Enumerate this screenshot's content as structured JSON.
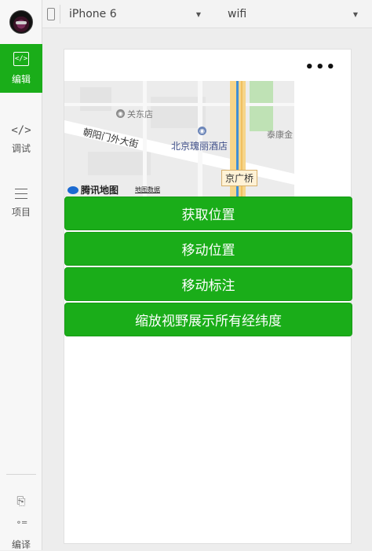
{
  "sidebar": {
    "items": [
      {
        "label": "编辑",
        "icon": "code-box-icon"
      },
      {
        "label": "调试",
        "icon": "code-icon"
      },
      {
        "label": "项目",
        "icon": "menu-icon"
      }
    ],
    "compile_label": "编译"
  },
  "toolbar": {
    "device": "iPhone 6",
    "network": "wifi"
  },
  "map": {
    "labels": {
      "guandong_store": "关东店",
      "chaoyangmen_street": "朝阳门外大街",
      "beijing_hotel": "北京瑰丽酒店",
      "taikang": "泰康金",
      "jingguang_bridge": "京广桥"
    },
    "logo_text": "腾讯地图",
    "credit_text": "地图数据"
  },
  "buttons": {
    "get_location": "获取位置",
    "move_location": "移动位置",
    "move_marker": "移动标注",
    "zoom_all": "缩放视野展示所有经纬度"
  },
  "colors": {
    "accent": "#1aad19"
  }
}
